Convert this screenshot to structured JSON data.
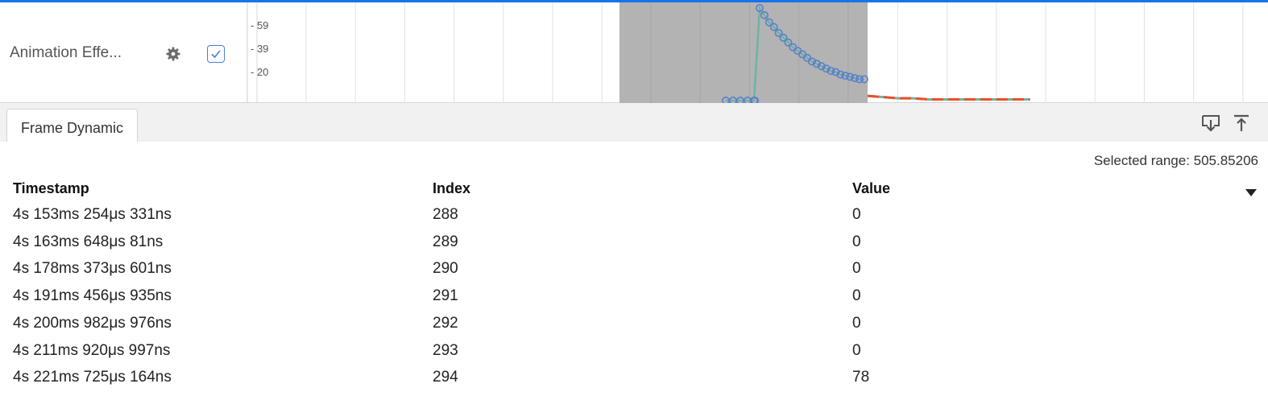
{
  "track": {
    "label": "Animation Effe...",
    "y_ticks": [
      "- 59",
      "- 39",
      "- 20"
    ]
  },
  "chart_data": {
    "type": "line",
    "title": "",
    "xlabel": "",
    "ylabel": "",
    "ylim": [
      0,
      78
    ],
    "y_tick_labels": [
      59,
      39,
      20
    ],
    "selection_band": true,
    "series": [
      {
        "color": "#5b7fc9",
        "markers": "circle",
        "x": [
          0,
          1,
          2,
          3,
          4,
          5,
          6,
          7,
          8,
          9,
          10,
          11,
          12,
          13,
          14,
          15,
          16,
          17,
          18,
          19,
          20,
          21,
          22,
          23,
          24,
          25,
          26,
          27,
          28
        ],
        "values": [
          0,
          0,
          0,
          0,
          0,
          0,
          78,
          72,
          66,
          62,
          57,
          53,
          49,
          45,
          42,
          39,
          36,
          33,
          31,
          29,
          27,
          25,
          24,
          22,
          21,
          20,
          19,
          18,
          18
        ]
      },
      {
        "color": "#e8502a",
        "markers": "none",
        "x": [
          28,
          31,
          34,
          37,
          40,
          44,
          48,
          52,
          56,
          60
        ],
        "values": [
          17,
          16,
          15,
          15,
          14,
          14,
          14,
          14,
          14,
          14
        ]
      }
    ]
  },
  "tabs": [
    {
      "label": "Frame Dynamic"
    }
  ],
  "toolbar": {
    "export_icon": "download-to-tray-icon",
    "top_icon": "move-to-top-icon"
  },
  "selected_range": "Selected range: 505.85206",
  "table": {
    "columns": [
      "Timestamp",
      "Index",
      "Value"
    ],
    "rows": [
      [
        "4s 153ms 254μs 331ns",
        "288",
        "0"
      ],
      [
        "4s 163ms 648μs 81ns",
        "289",
        "0"
      ],
      [
        "4s 178ms 373μs 601ns",
        "290",
        "0"
      ],
      [
        "4s 191ms 456μs 935ns",
        "291",
        "0"
      ],
      [
        "4s 200ms 982μs 976ns",
        "292",
        "0"
      ],
      [
        "4s 211ms 920μs 997ns",
        "293",
        "0"
      ],
      [
        "4s 221ms 725μs 164ns",
        "294",
        "78"
      ]
    ]
  }
}
